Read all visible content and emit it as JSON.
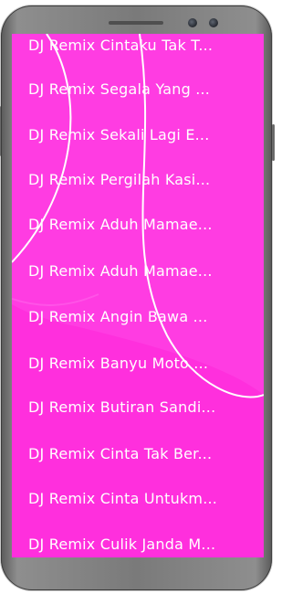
{
  "accent_color": "#ff2fdd",
  "list_items": [
    {
      "label": "DJ Remix Cintaku Tak T..."
    },
    {
      "label": "DJ Remix Segala Yang ..."
    },
    {
      "label": "DJ Remix Sekali Lagi E..."
    },
    {
      "label": "DJ Remix Pergilah Kasi..."
    },
    {
      "label": "DJ Remix Aduh Mamae..."
    },
    {
      "label": "DJ Remix Aduh Mamae..."
    },
    {
      "label": "DJ Remix Angin Bawa ..."
    },
    {
      "label": "DJ Remix Banyu Moto ..."
    },
    {
      "label": "DJ Remix Butiran Sandi..."
    },
    {
      "label": "DJ Remix Cinta Tak Ber..."
    },
    {
      "label": "DJ Remix Cinta Untukm..."
    },
    {
      "label": "DJ Remix Culik Janda M..."
    }
  ]
}
